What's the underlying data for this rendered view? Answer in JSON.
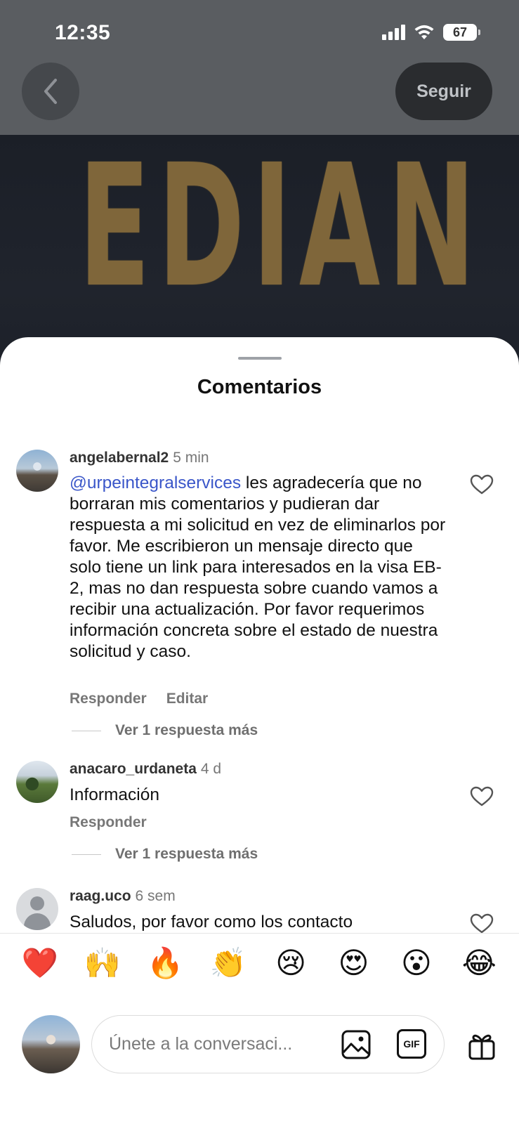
{
  "status_bar": {
    "time": "12:35",
    "battery": "67"
  },
  "header": {
    "follow_label": "Seguir"
  },
  "video": {
    "overlay_text": "EDIAN E"
  },
  "sheet": {
    "title": "Comentarios"
  },
  "comments": [
    {
      "username": "angelabernal2",
      "time": "5 min",
      "mention": "@urpeintegralservices",
      "text": " les agradecería que no borraran mis comentarios y pudieran dar respuesta a mi solicitud en vez de eliminarlos por favor. Me escribieron un mensaje directo que solo tiene un link para interesados en la visa EB-2, mas no dan respuesta sobre cuando vamos a recibir una actualización. Por favor requerimos información concreta sobre el estado de nuestra solicitud y caso.",
      "actions": [
        "Responder",
        "Editar"
      ],
      "replies": "Ver 1 respuesta más"
    },
    {
      "username": "anacaro_urdaneta",
      "time": "4 d",
      "text": "Información",
      "actions": [
        "Responder"
      ],
      "replies": "Ver 1 respuesta más"
    },
    {
      "username": "raag.uco",
      "time": "6 sem",
      "text": "Saludos, por favor como los contacto"
    }
  ],
  "reactions": [
    "❤️",
    "🙌",
    "🔥",
    "👏",
    "😢",
    "😍",
    "😮",
    "😂"
  ],
  "composer": {
    "placeholder": "Únete a la conversaci..."
  },
  "icons": {
    "gif_label": "GIF"
  }
}
